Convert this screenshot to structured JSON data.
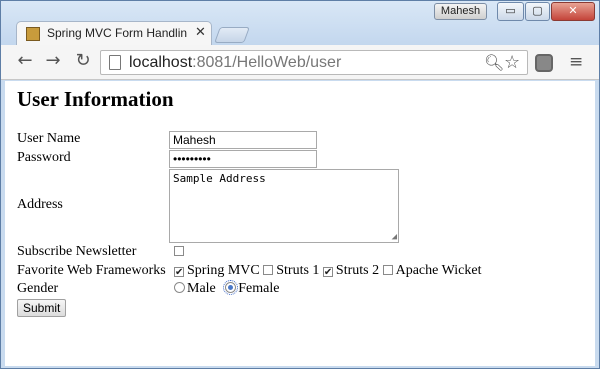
{
  "browser": {
    "profile_name": "Mahesh",
    "tab_title": "Spring MVC Form Handlin",
    "url_host": "localhost",
    "url_rest": ":8081/HelloWeb/user",
    "window_controls": {
      "minimize": "▭",
      "maximize": "▢",
      "close": "✕"
    },
    "icons": [
      "back-icon",
      "forward-icon",
      "reload-icon",
      "page-icon",
      "zoom-icon",
      "star-icon",
      "extension-icon",
      "menu-icon"
    ]
  },
  "page": {
    "heading": "User Information",
    "fields": {
      "username_label": "User Name",
      "username_value": "Mahesh",
      "password_label": "Password",
      "password_value": "•••••••••",
      "address_label": "Address",
      "address_value": "Sample Address",
      "newsletter_label": "Subscribe Newsletter",
      "newsletter_checked": false,
      "frameworks_label": "Favorite Web Frameworks",
      "frameworks": [
        {
          "label": "Spring MVC",
          "checked": true
        },
        {
          "label": "Struts 1",
          "checked": false
        },
        {
          "label": "Struts 2",
          "checked": true
        },
        {
          "label": "Apache Wicket",
          "checked": false
        }
      ],
      "gender_label": "Gender",
      "gender_options": [
        {
          "label": "Male",
          "checked": false
        },
        {
          "label": "Female",
          "checked": true
        }
      ]
    },
    "submit_label": "Submit"
  }
}
